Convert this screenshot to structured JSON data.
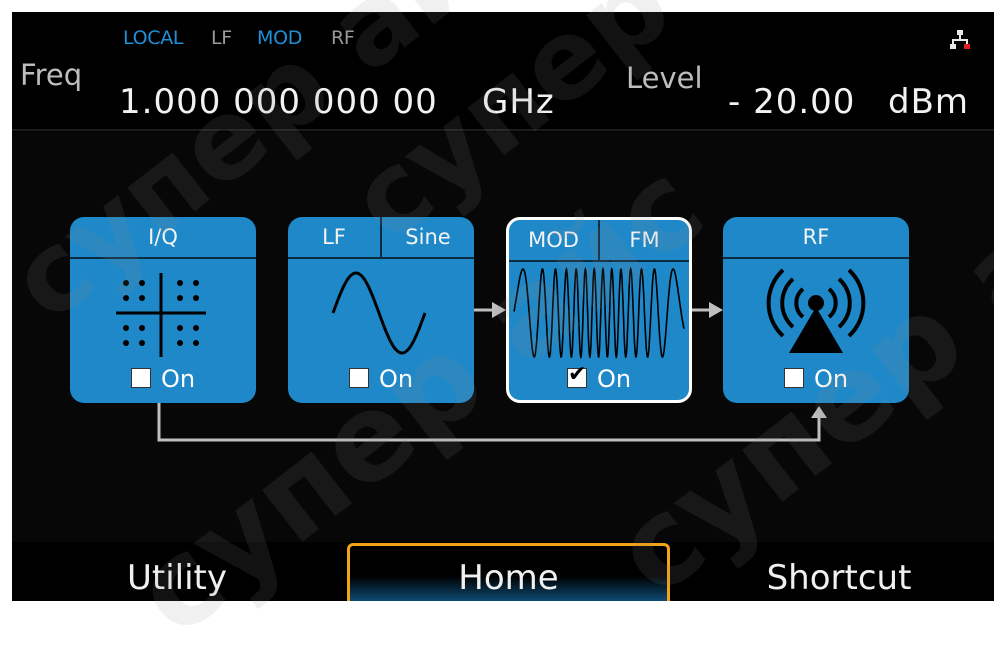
{
  "status_bar": {
    "items": [
      {
        "label": "LOCAL",
        "color": "#1f8fd8"
      },
      {
        "label": "LF",
        "color": "#9a9a9a"
      },
      {
        "label": "MOD",
        "color": "#1f8fd8"
      },
      {
        "label": "RF",
        "color": "#9a9a9a"
      }
    ],
    "network_icon": "network-icon"
  },
  "freq": {
    "label": "Freq",
    "value": "1.000 000 000 00",
    "unit": "GHz"
  },
  "level": {
    "label": "Level",
    "value": "- 20.00",
    "unit": "dBm"
  },
  "blocks": {
    "iq": {
      "title": "I/Q",
      "enabled_label": "On",
      "checked": false,
      "icon": "constellation-icon"
    },
    "lf": {
      "title": "LF",
      "subtitle": "Sine",
      "enabled_label": "On",
      "checked": false,
      "icon": "sine-wave-icon"
    },
    "mod": {
      "title": "MOD",
      "subtitle": "FM",
      "enabled_label": "On",
      "checked": true,
      "icon": "fm-waveform-icon"
    },
    "rf": {
      "title": "RF",
      "enabled_label": "On",
      "checked": false,
      "icon": "antenna-icon"
    }
  },
  "softkeys": {
    "utility": "Utility",
    "home": "Home",
    "shortcut": "Shortcut"
  },
  "watermark": "супер айс",
  "colors": {
    "accent": "#1f88c8",
    "selected_border": "#ffffff",
    "home_highlight": "#f3a316",
    "status_active": "#1f8fd8"
  }
}
